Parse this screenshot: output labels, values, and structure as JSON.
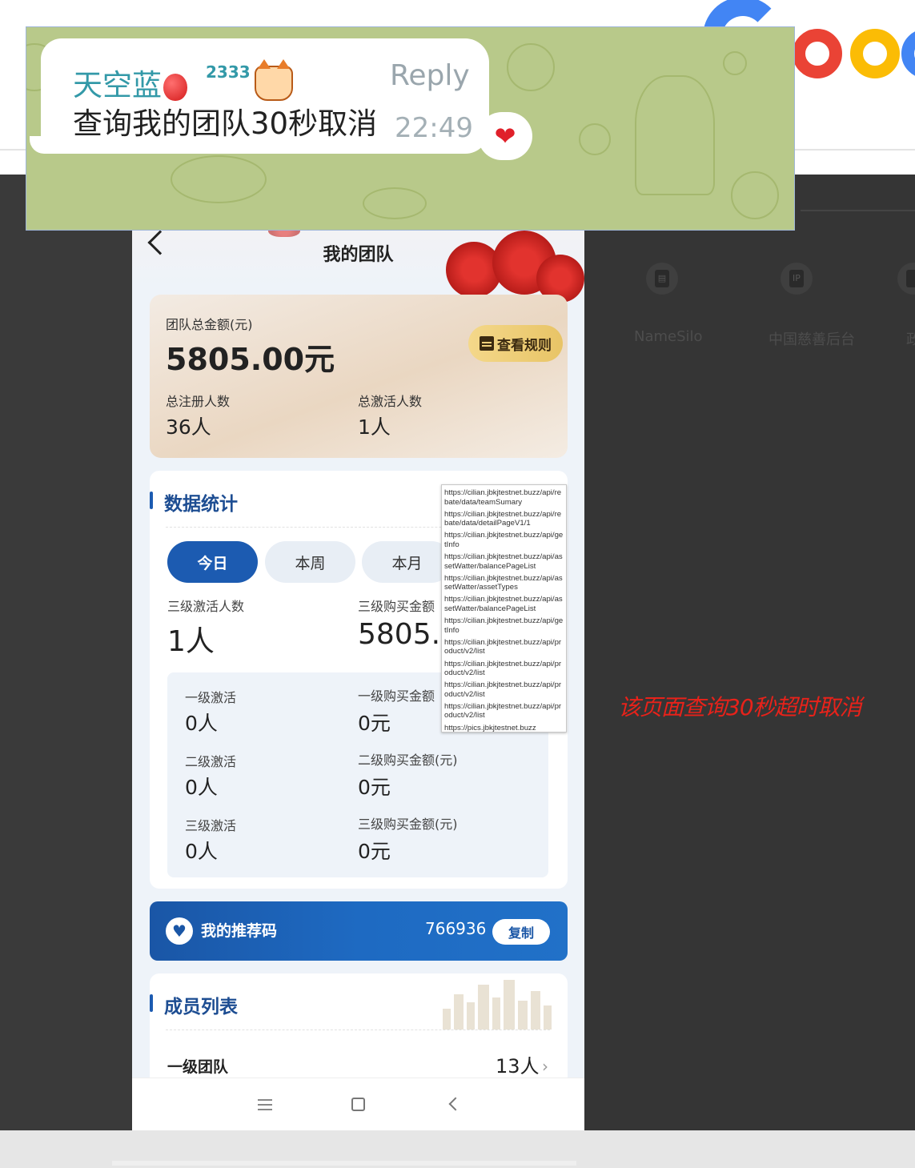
{
  "browser": {
    "shortcuts": [
      {
        "label": "NameSilo",
        "icon": "document-icon"
      },
      {
        "label": "中国慈善后台",
        "icon": "ip-icon"
      },
      {
        "label": "政",
        "icon": "generic-icon"
      }
    ],
    "note": "该页面查询30秒超时取消",
    "colors": {
      "note": "#e8221a",
      "google_blue": "#4285f4",
      "google_red": "#ea4335",
      "google_yellow": "#fbbc05"
    }
  },
  "chat": {
    "sender": "天空蓝",
    "score": "2333",
    "reply_label": "Reply",
    "message": "查询我的团队30秒取消",
    "time": "22:49",
    "reaction": "❤",
    "colors": {
      "background": "#b8c98a",
      "sender": "#3399a8"
    }
  },
  "phone": {
    "title": "我的团队",
    "summary": {
      "total_amount_label": "团队总金额(元)",
      "total_amount": "5805.00元",
      "rules_button": "查看规则",
      "registered_label": "总注册人数",
      "registered_value": "36人",
      "activated_label": "总激活人数",
      "activated_value": "1人"
    },
    "stats": {
      "title": "数据统计",
      "tabs": [
        "今日",
        "本周",
        "本月"
      ],
      "active_tab": "今日",
      "level3_activated_label": "三级激活人数",
      "level3_activated_value": "1人",
      "level3_purchase_label": "三级购买金额",
      "level3_purchase_value": "5805.0",
      "rows": [
        {
          "activate_label": "一级激活",
          "activate_value": "0人",
          "purchase_label": "一级购买金额",
          "purchase_value": "0元"
        },
        {
          "activate_label": "二级激活",
          "activate_value": "0人",
          "purchase_label": "二级购买金额(元)",
          "purchase_value": "0元"
        },
        {
          "activate_label": "三级激活",
          "activate_value": "0人",
          "purchase_label": "三级购买金额(元)",
          "purchase_value": "0元"
        }
      ]
    },
    "url_popup": [
      "https://cilian.jbkjtestnet.buzz/api/rebate/data/teamSumary",
      "https://cilian.jbkjtestnet.buzz/api/rebate/data/detailPageV1/1",
      "https://cilian.jbkjtestnet.buzz/api/getInfo",
      "https://cilian.jbkjtestnet.buzz/api/assetWatter/balancePageList",
      "https://cilian.jbkjtestnet.buzz/api/assetWatter/assetTypes",
      "https://cilian.jbkjtestnet.buzz/api/assetWatter/balancePageList",
      "https://cilian.jbkjtestnet.buzz/api/getInfo",
      "https://cilian.jbkjtestnet.buzz/api/product/v2/list",
      "https://cilian.jbkjtestnet.buzz/api/product/v2/list",
      "https://cilian.jbkjtestnet.buzz/api/product/v2/list",
      "https://cilian.jbkjtestnet.buzz/api/product/v2/list",
      "https://pics.jbkjtestnet.buzz"
    ],
    "referral": {
      "label": "我的推荐码",
      "code": "766936",
      "copy_button": "复制"
    },
    "members": {
      "title": "成员列表",
      "row_label": "一级团队",
      "row_value": "13人"
    },
    "colors": {
      "primary": "#1c5bb1",
      "section_title": "#1d4d92",
      "rules_button": "#e8c466"
    }
  }
}
